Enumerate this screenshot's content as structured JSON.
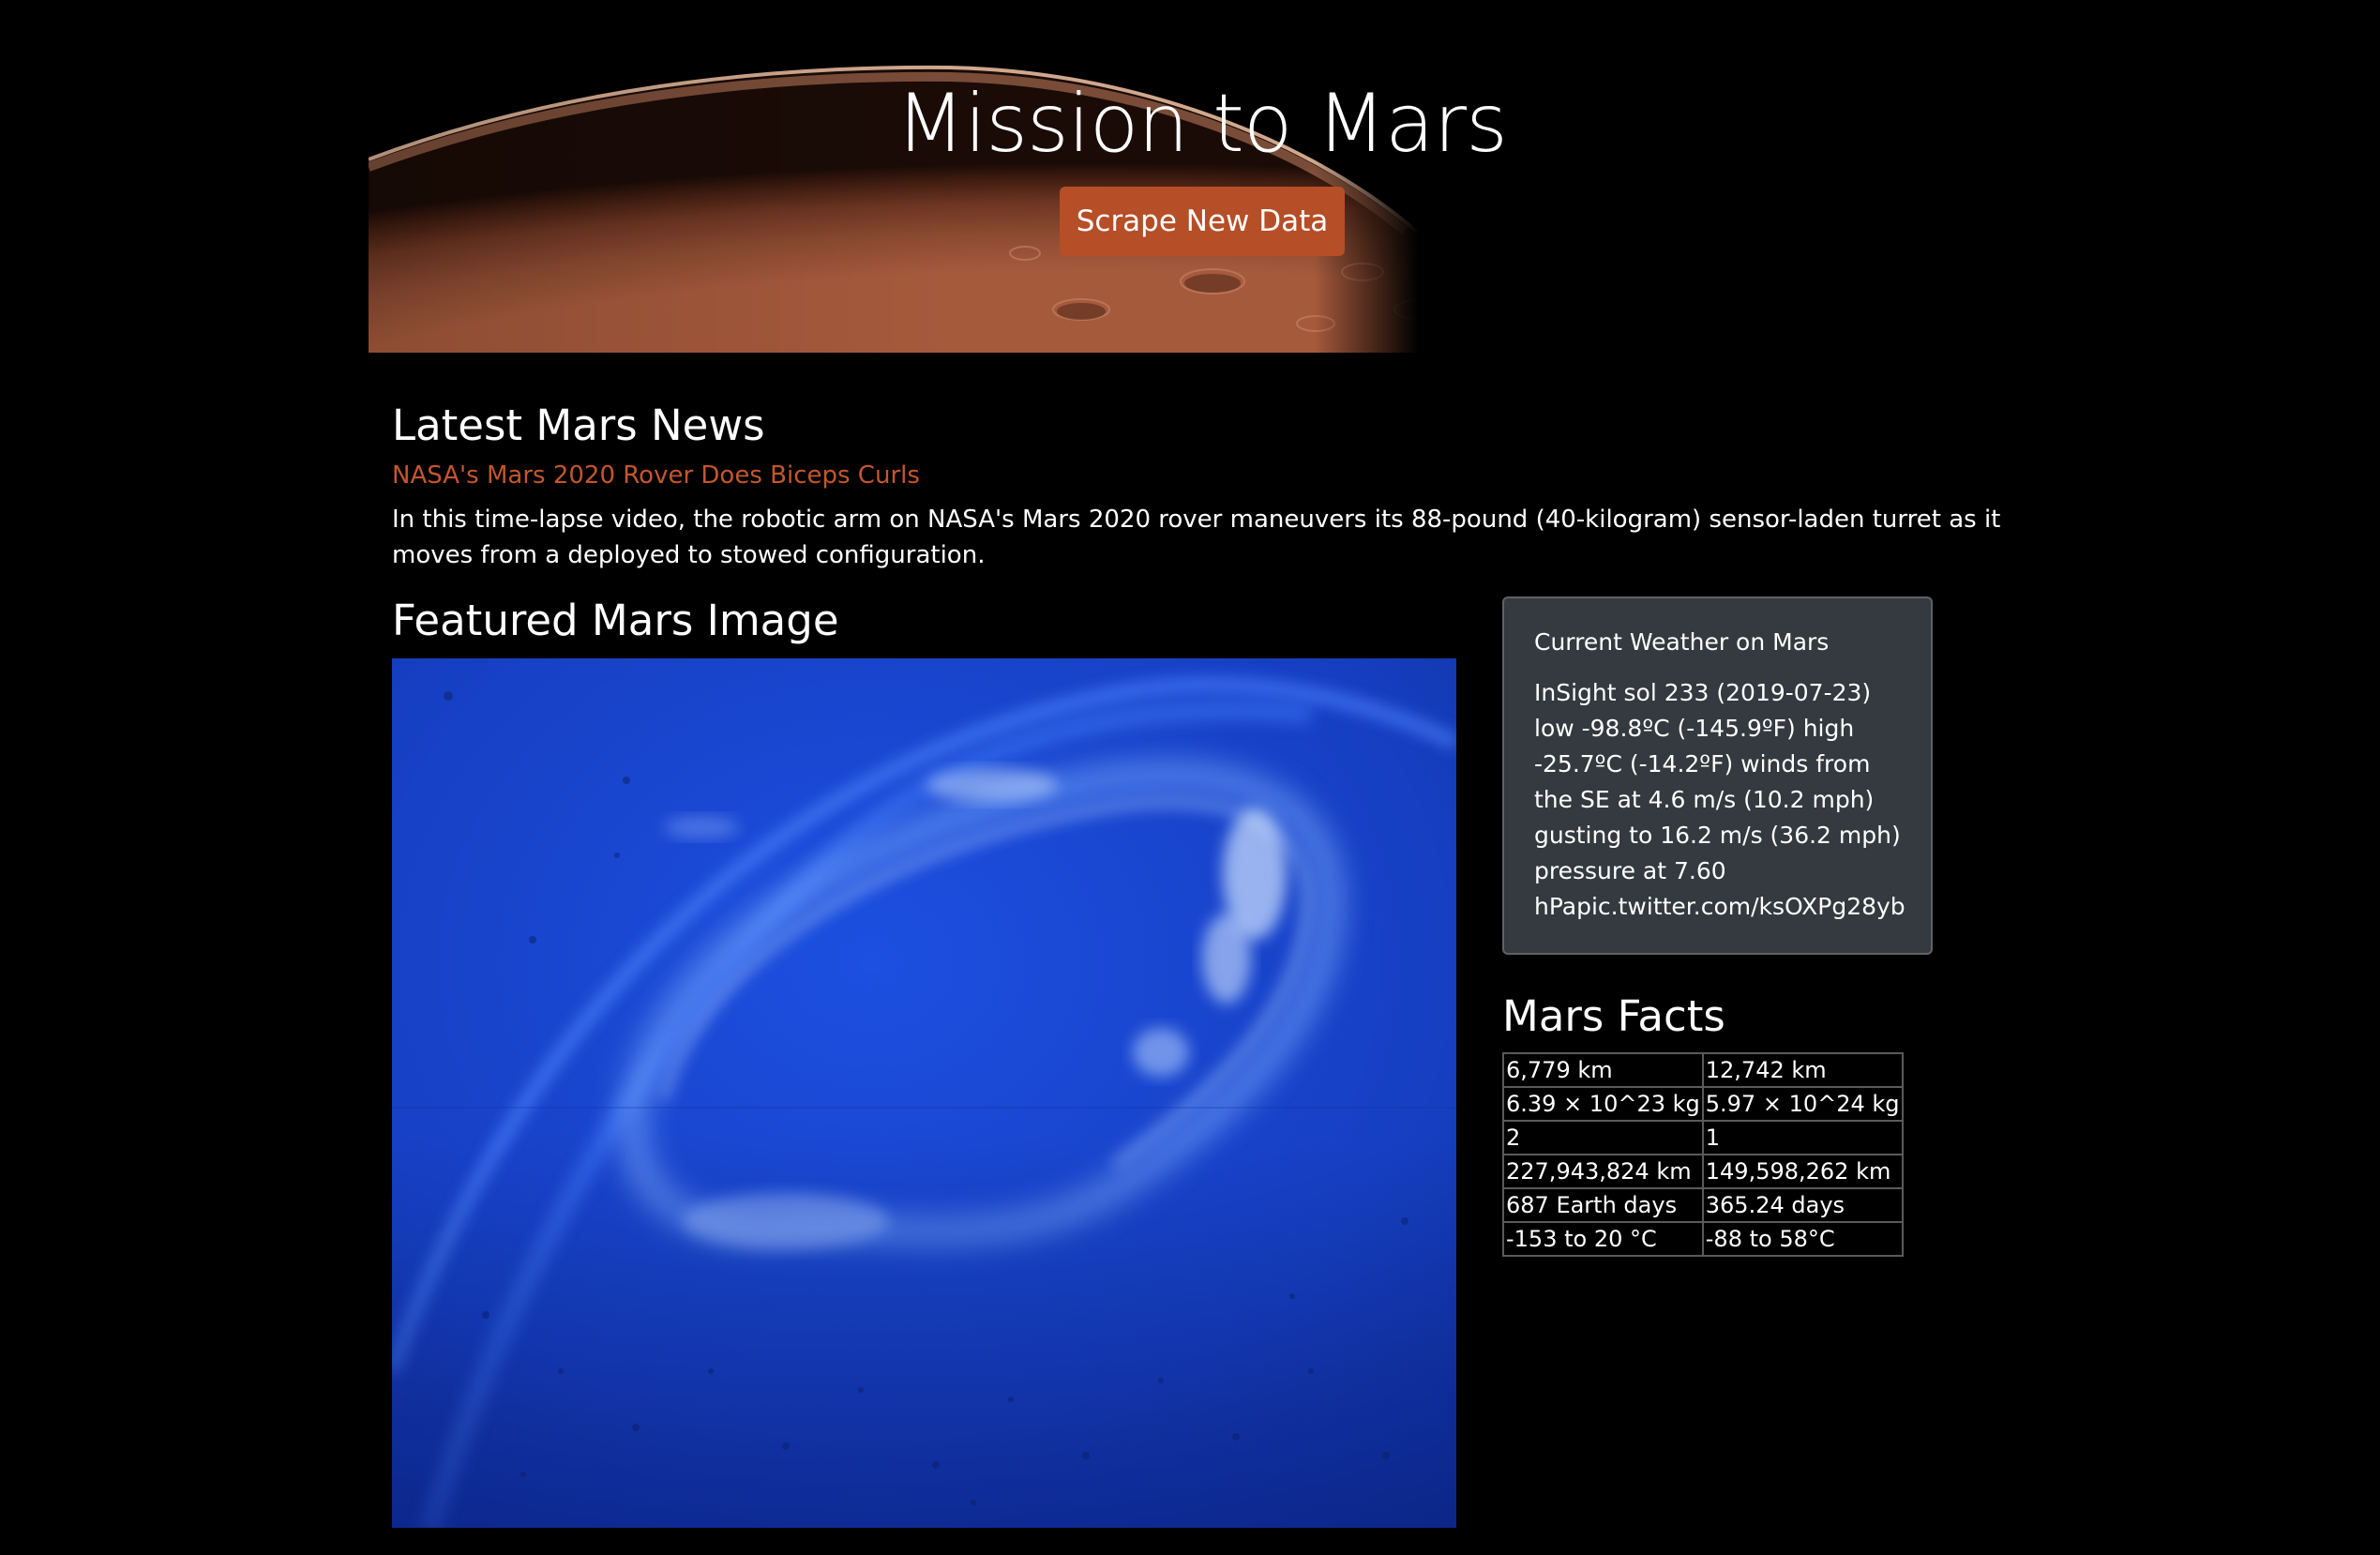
{
  "header": {
    "title": "Mission to Mars",
    "scrape_button": "Scrape New Data"
  },
  "news": {
    "heading": "Latest Mars News",
    "title": "NASA's Mars 2020 Rover Does Biceps Curls",
    "teaser": "In this time-lapse video, the robotic arm on NASA's Mars 2020 rover maneuvers its 88-pound (40-kilogram) sensor-laden turret as it moves from a deployed to stowed configuration."
  },
  "featured": {
    "heading": "Featured Mars Image"
  },
  "weather": {
    "title": "Current Weather on Mars",
    "text": "InSight sol 233 (2019-07-23) low -98.8ºC (-145.9ºF) high -25.7ºC (-14.2ºF) winds from the SE at 4.6 m/s (10.2 mph) gusting to 16.2 m/s (36.2 mph) pressure at 7.60 hPapic.twitter.com/ksOXPg28yb"
  },
  "facts": {
    "heading": "Mars Facts",
    "rows": [
      [
        "6,779 km",
        "12,742 km"
      ],
      [
        "6.39 × 10^23 kg",
        "5.97 × 10^24 kg"
      ],
      [
        "2",
        "1"
      ],
      [
        "227,943,824 km",
        "149,598,262 km"
      ],
      [
        "687 Earth days",
        "365.24 days"
      ],
      [
        "-153 to 20 °C",
        "-88 to 58°C"
      ]
    ]
  },
  "colors": {
    "background": "#000000",
    "accent": "#b64e27",
    "link": "#c4562c",
    "card": "#343a3f"
  }
}
